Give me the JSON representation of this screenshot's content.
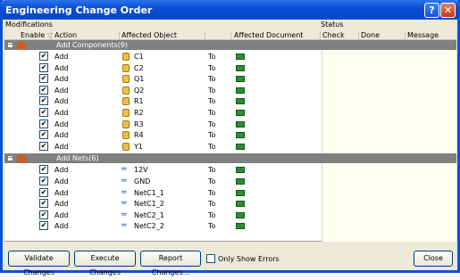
{
  "window": {
    "title": "Engineering Change Order"
  },
  "group_labels": {
    "modifications": "Modifications",
    "status": "Status"
  },
  "columns": {
    "enable": "Enable",
    "action": "Action",
    "affected_object": "Affected Object",
    "affected_document": "Affected Document",
    "check": "Check",
    "done": "Done",
    "message": "Message"
  },
  "groups": [
    {
      "title": "Add Components(9)",
      "rows": [
        {
          "action": "Add",
          "object": "C1",
          "to": "To"
        },
        {
          "action": "Add",
          "object": "C2",
          "to": "To"
        },
        {
          "action": "Add",
          "object": "Q1",
          "to": "To"
        },
        {
          "action": "Add",
          "object": "Q2",
          "to": "To"
        },
        {
          "action": "Add",
          "object": "R1",
          "to": "To"
        },
        {
          "action": "Add",
          "object": "R2",
          "to": "To"
        },
        {
          "action": "Add",
          "object": "R3",
          "to": "To"
        },
        {
          "action": "Add",
          "object": "R4",
          "to": "To"
        },
        {
          "action": "Add",
          "object": "Y1",
          "to": "To"
        }
      ]
    },
    {
      "title": "Add Nets(6)",
      "rows": [
        {
          "action": "Add",
          "object": "12V",
          "to": "To"
        },
        {
          "action": "Add",
          "object": "GND",
          "to": "To"
        },
        {
          "action": "Add",
          "object": "NetC1_1",
          "to": "To"
        },
        {
          "action": "Add",
          "object": "NetC1_2",
          "to": "To"
        },
        {
          "action": "Add",
          "object": "NetC2_1",
          "to": "To"
        },
        {
          "action": "Add",
          "object": "NetC2_2",
          "to": "To"
        }
      ]
    }
  ],
  "buttons": {
    "validate": "Validate Changes",
    "execute": "Execute Changes",
    "report": "Report Changes...",
    "only_errors": "Only Show Errors",
    "close": "Close"
  },
  "icons": {
    "component": "component-icon",
    "net": "net-icon",
    "document": "pcb-document-icon",
    "folder": "folder-icon"
  },
  "colors": {
    "title_bar": "#0a53d8",
    "group_row": "#808080",
    "status_pane": "#fffff0"
  }
}
